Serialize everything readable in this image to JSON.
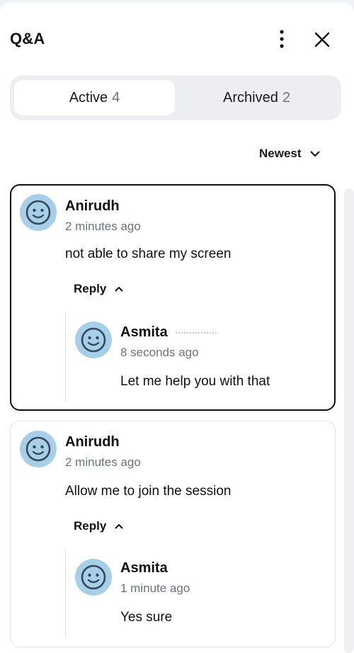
{
  "header": {
    "title": "Q&A",
    "more_icon": "more-vertical-icon",
    "close_icon": "close-icon"
  },
  "tabs": [
    {
      "label": "Active",
      "count": "4",
      "selected": true
    },
    {
      "label": "Archived",
      "count": "2",
      "selected": false
    }
  ],
  "sort": {
    "label": "Newest",
    "icon": "chevron-down-icon"
  },
  "questions": [
    {
      "author": "Anirudh",
      "time": "2 minutes ago",
      "text": "not able to share my screen",
      "reply_label": "Reply",
      "selected": true,
      "reply": {
        "author": "Asmita",
        "time": "8 seconds ago",
        "text": "Let me help you with that"
      }
    },
    {
      "author": "Anirudh",
      "time": "2 minutes ago",
      "text": "Allow me to join the session",
      "reply_label": "Reply",
      "selected": false,
      "reply": {
        "author": "Asmita",
        "time": "1 minute ago",
        "text": "Yes sure"
      }
    }
  ],
  "colors": {
    "avatar_bg": "#a7cfe8",
    "avatar_face": "#34495e",
    "muted_text": "#6b7280",
    "selected_border": "#111111"
  }
}
